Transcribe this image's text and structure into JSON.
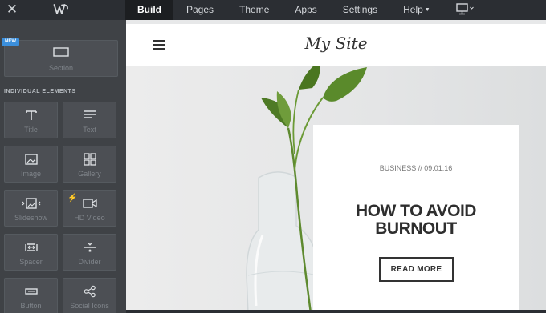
{
  "topbar": {
    "nav": [
      "Build",
      "Pages",
      "Theme",
      "Apps",
      "Settings",
      "Help"
    ],
    "active_tab": "Build"
  },
  "sidebar": {
    "badge": "NEW",
    "section_label": "Section",
    "group_heading": "INDIVIDUAL ELEMENTS",
    "elements": [
      {
        "label": "Title",
        "icon": "title-icon"
      },
      {
        "label": "Text",
        "icon": "text-icon"
      },
      {
        "label": "Image",
        "icon": "image-icon"
      },
      {
        "label": "Gallery",
        "icon": "gallery-icon"
      },
      {
        "label": "Slideshow",
        "icon": "slideshow-icon"
      },
      {
        "label": "HD Video",
        "icon": "video-icon"
      },
      {
        "label": "Spacer",
        "icon": "spacer-icon"
      },
      {
        "label": "Divider",
        "icon": "divider-icon"
      },
      {
        "label": "Button",
        "icon": "button-icon"
      },
      {
        "label": "Social Icons",
        "icon": "share-icon"
      }
    ]
  },
  "site": {
    "title": "My Site",
    "post": {
      "category": "BUSINESS",
      "separator": "//",
      "date": "09.01.16",
      "headline_line1": "HOW TO AVOID",
      "headline_line2": "BURNOUT",
      "cta": "READ MORE"
    }
  },
  "colors": {
    "topbar": "#2b2e33",
    "sidebar": "#3f4246",
    "tile": "#4c4f54",
    "badge": "#3b8fdc",
    "bolt": "#f5a623"
  }
}
